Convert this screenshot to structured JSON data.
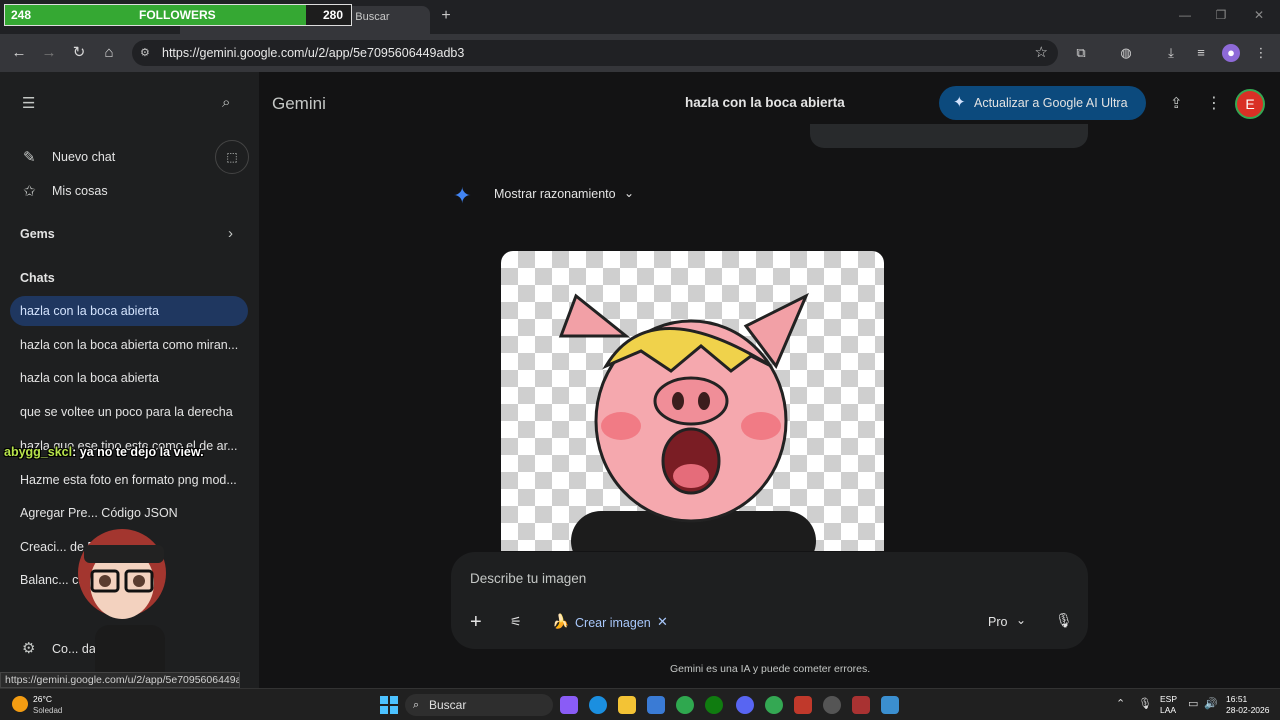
{
  "overlay": {
    "followers": {
      "start": "248",
      "label": "FOLLOWERS",
      "goal": "280",
      "progress": 0.87
    },
    "chat": {
      "user": "abygg_skcl",
      "message": ": ya no te dejo la view."
    }
  },
  "browser": {
    "tab_title": "a cigua - Buscar",
    "new_tab": "+",
    "url": "https://gemini.google.com/u/2/app/5e7095606449adb3",
    "status_url": "https://gemini.google.com/u/2/app/5e7095606449adb3"
  },
  "sidebar": {
    "new_chat": "Nuevo chat",
    "my_stuff": "Mis cosas",
    "gems": "Gems",
    "chats_heading": "Chats",
    "chats": [
      "hazla con la boca abierta",
      "hazla con la boca abierta como miran...",
      "hazla con la boca abierta",
      "que se voltee un poco para la derecha",
      "hazla que ese tipo este como el de ar...",
      "Hazme esta foto en formato png mod...",
      "Agregar Pre... Código JSON",
      "Creaci... de Expo T...",
      "Balanc... cado"
    ],
    "settings": "Co... da"
  },
  "header": {
    "app_name": "Gemini",
    "conversation_title": "hazla con la boca abierta",
    "upgrade_label": "Actualizar a Google AI Ultra",
    "avatar_initial": "E"
  },
  "response": {
    "reasoning_label": "Mostrar razonamiento"
  },
  "composer": {
    "placeholder": "Describe tu imagen",
    "chip_label": "Crear imagen",
    "chip_icon": "🍌",
    "model": "Pro",
    "disclaimer": "Gemini es una IA y puede cometer errores."
  },
  "taskbar": {
    "weather_temp": "26°C",
    "weather_location": "Soledad",
    "search_label": "Buscar",
    "lang1": "ESP",
    "lang2": "LAA",
    "time": "16:51",
    "date": "28-02-2026"
  },
  "colors": {
    "background": "#131314",
    "sidebar": "#1e1f20",
    "active_chat": "#1f3760",
    "upgrade_button": "#0c4a7d",
    "gemini_star": "#4285f4",
    "followers_bar": "#35a833"
  }
}
